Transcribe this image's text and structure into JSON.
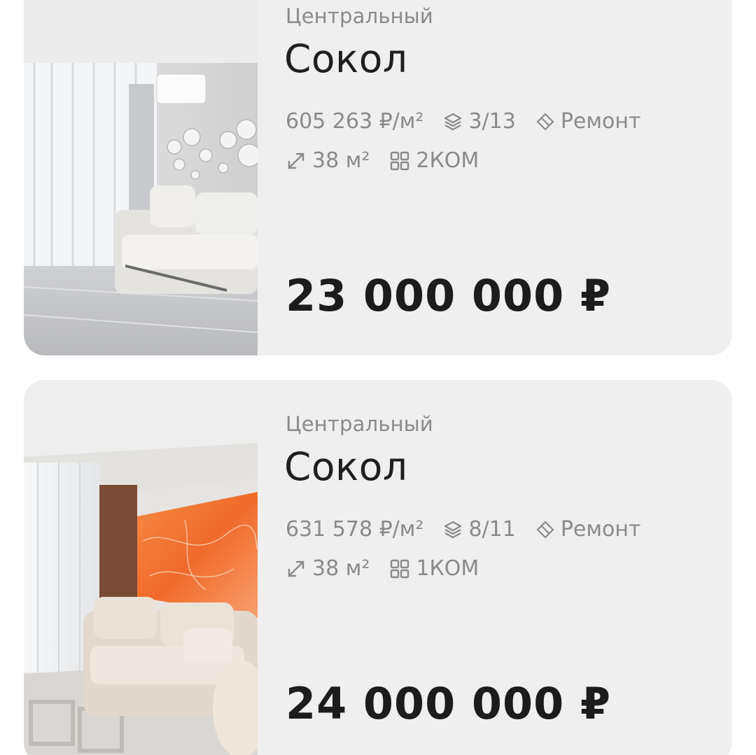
{
  "listings": [
    {
      "district": "Центральный",
      "title": "Сокол",
      "price_per_m2": "605 263 ₽/м²",
      "floor": "3/13",
      "renovation": "Ремонт",
      "area": "38 м²",
      "rooms": "2КОМ",
      "price": "23 000 000 ₽"
    },
    {
      "district": "Центральный",
      "title": "Сокол",
      "price_per_m2": "631 578 ₽/м²",
      "floor": "8/11",
      "renovation": "Ремонт",
      "area": "38 м²",
      "rooms": "1КОМ",
      "price": "24 000 000 ₽"
    }
  ],
  "colors": {
    "card_bg": "#efefef",
    "text_primary": "#1f1f1f",
    "text_secondary": "#8a8a8a",
    "accent_orange": "#f07a3a"
  },
  "icons": [
    "layers-icon",
    "tag-icon",
    "resize-arrows-icon",
    "rooms-grid-icon"
  ]
}
